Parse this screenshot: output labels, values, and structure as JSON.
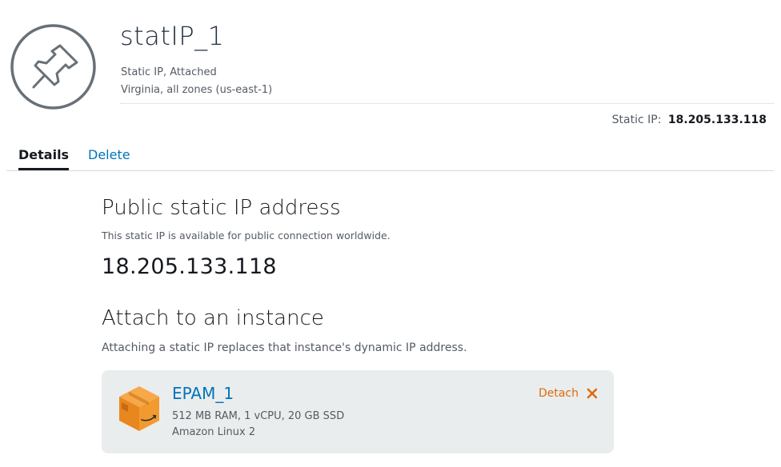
{
  "header": {
    "icon": "pushpin-icon",
    "title": "statIP_1",
    "status": "Static IP, Attached",
    "region": "Virginia, all zones (us-east-1)",
    "ip_label": "Static IP:",
    "ip_value": "18.205.133.118"
  },
  "tabs": [
    {
      "label": "Details",
      "active": true
    },
    {
      "label": "Delete",
      "active": false
    }
  ],
  "public_section": {
    "heading": "Public static IP address",
    "description": "This static IP is available for public connection worldwide.",
    "ip": "18.205.133.118"
  },
  "attach_section": {
    "heading": "Attach to an instance",
    "description": "Attaching a static IP replaces that instance's dynamic IP address.",
    "instance": {
      "icon": "instance-box-icon",
      "name": "EPAM_1",
      "specs": "512 MB RAM, 1 vCPU, 20 GB SSD",
      "os": "Amazon Linux 2",
      "detach_label": "Detach",
      "detach_icon": "close-icon"
    }
  },
  "colors": {
    "link": "#0073bb",
    "action": "#dd6b10",
    "card_bg": "#eaeded",
    "box_orange": "#f0922b"
  }
}
